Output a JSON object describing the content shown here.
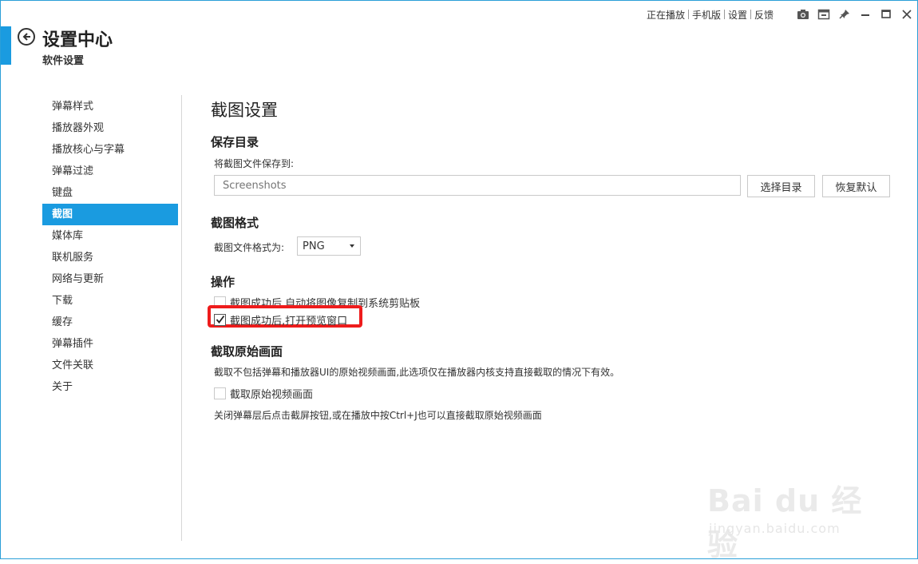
{
  "colors": {
    "accent": "#1a9be0",
    "highlight": "#ee1c1c",
    "border": "#2a9fd8"
  },
  "header": {
    "title": "设置中心",
    "subtitle": "软件设置"
  },
  "topbar": {
    "links": [
      "正在播放",
      "手机版",
      "设置",
      "反馈"
    ],
    "tools": [
      "camera-icon",
      "mini-mode-icon",
      "pin-icon",
      "minimize-icon",
      "maximize-icon",
      "close-icon"
    ]
  },
  "sidebar": {
    "items": [
      {
        "label": "弹幕样式"
      },
      {
        "label": "播放器外观"
      },
      {
        "label": "播放核心与字幕"
      },
      {
        "label": "弹幕过滤"
      },
      {
        "label": "键盘"
      },
      {
        "label": "截图"
      },
      {
        "label": "媒体库"
      },
      {
        "label": "联机服务"
      },
      {
        "label": "网络与更新"
      },
      {
        "label": "下载"
      },
      {
        "label": "缓存"
      },
      {
        "label": "弹幕插件"
      },
      {
        "label": "文件关联"
      },
      {
        "label": "关于"
      }
    ],
    "active_index": 5
  },
  "main": {
    "section_title": "截图设置",
    "save_dir": {
      "heading": "保存目录",
      "label": "将截图文件保存到:",
      "value": "",
      "placeholder": "Screenshots",
      "choose_button": "选择目录",
      "reset_button": "恢复默认"
    },
    "format": {
      "heading": "截图格式",
      "label": "截图文件格式为:",
      "selected": "PNG"
    },
    "actions": {
      "heading": "操作",
      "options": [
        {
          "label": "截图成功后,自动将图像复制到系统剪贴板",
          "checked": false
        },
        {
          "label": "截图成功后,打开预览窗口",
          "checked": true
        }
      ]
    },
    "raw": {
      "heading": "截取原始画面",
      "description": "截取不包括弹幕和播放器UI的原始视频画面,此选项仅在播放器内核支持直接截取的情况下有效。",
      "option": {
        "label": "截取原始视频画面",
        "checked": false
      },
      "note": "关闭弹幕层后点击截屏按钮,或在播放中按Ctrl+J也可以直接截取原始视频画面"
    }
  },
  "watermark": {
    "main": "Bai du 经验",
    "sub": "jingyan.baidu.com"
  }
}
